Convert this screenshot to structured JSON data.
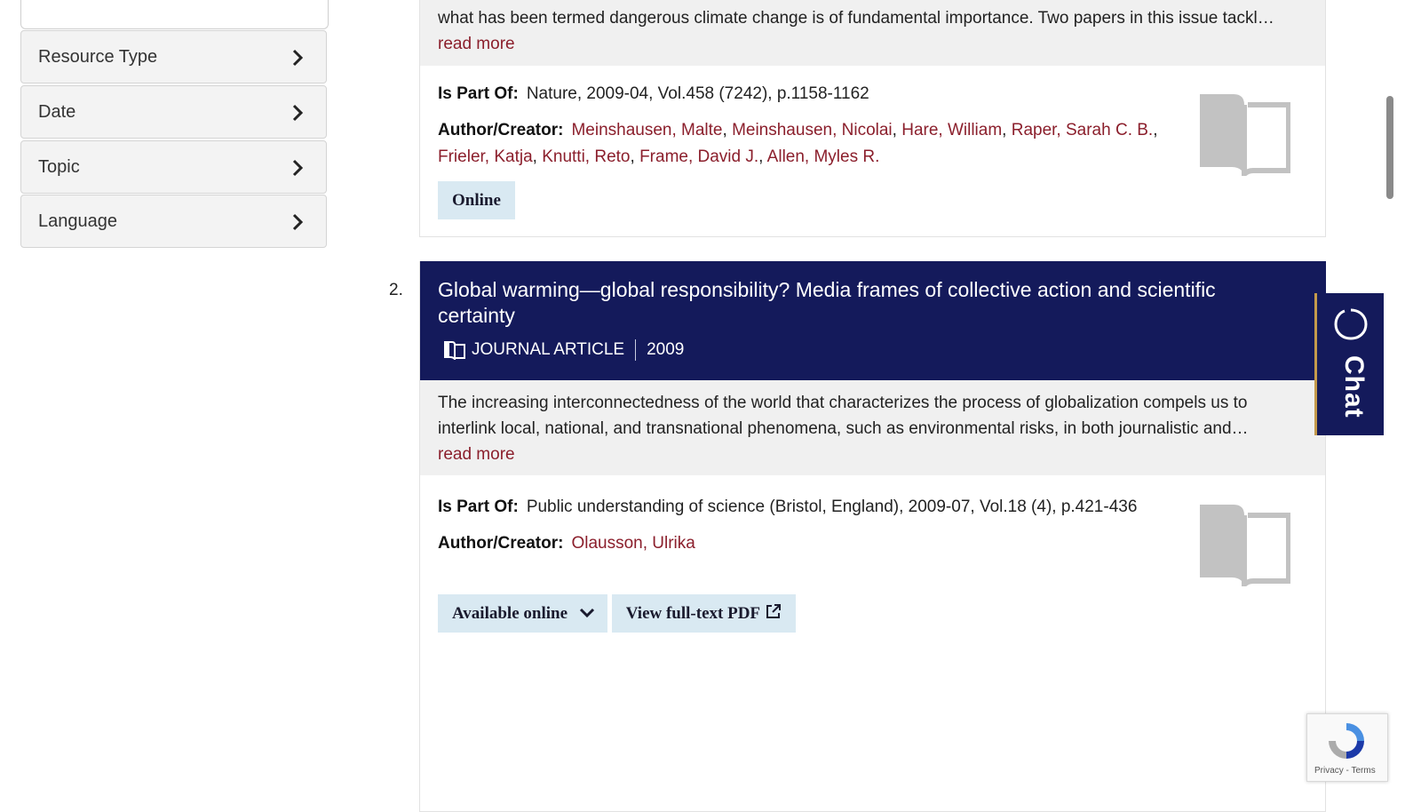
{
  "sidebar": {
    "facets": [
      {
        "label": "Resource Type"
      },
      {
        "label": "Date"
      },
      {
        "label": "Topic"
      },
      {
        "label": "Language"
      }
    ]
  },
  "result1": {
    "snippet_tail": "what has been termed dangerous climate change is of fundamental importance. Two papers in this issue tackl…",
    "read_more": "read more",
    "is_part_of_label": "Is Part Of:",
    "is_part_of": "Nature, 2009-04, Vol.458 (7242), p.1158-1162",
    "author_label": "Author/Creator:",
    "authors_line1": [
      "Meinshausen, Malte",
      "Meinshausen, Nicolai",
      "Hare, William",
      "Raper, Sarah C. B."
    ],
    "authors_line2": [
      "Frieler, Katja",
      "Knutti, Reto",
      "Frame, David J.",
      "Allen, Myles R."
    ],
    "online_button": "Online"
  },
  "result2": {
    "number": "2.",
    "title_line1": "Global warming—global responsibility? Media frames of collective action and scientific",
    "title_line2": "certainty",
    "type": "JOURNAL ARTICLE",
    "year": "2009",
    "snippet_line1": "The increasing interconnectedness of the world that characterizes the process of globalization compels us to",
    "snippet_line2": "interlink local, national, and transnational phenomena, such as environmental risks, in both journalistic and…",
    "read_more": "read more",
    "is_part_of_label": "Is Part Of:",
    "is_part_of": "Public understanding of science (Bristol, England), 2009-07, Vol.18 (4), p.421-436",
    "author_label": "Author/Creator:",
    "author": "Olausson, Ulrika",
    "available_button": "Available online",
    "pdf_button": "View full-text PDF"
  },
  "chat": {
    "label": "Chat"
  },
  "recaptcha": {
    "text": "Privacy - Terms"
  },
  "colors": {
    "navy": "#141a5b",
    "link": "#8b1f2c",
    "button_bg": "#d9e9f2"
  }
}
